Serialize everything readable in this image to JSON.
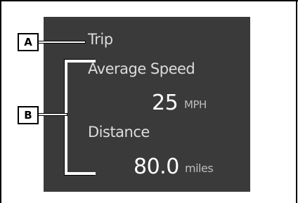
{
  "callouts": {
    "a": "A",
    "b": "B"
  },
  "display": {
    "title": "Trip",
    "average_speed_label": "Average Speed",
    "speed_value": "25",
    "speed_unit": "MPH",
    "distance_label": "Distance",
    "distance_value": "80.0",
    "distance_unit": "miles"
  },
  "colors": {
    "screen_background": "#3a3a3b",
    "label_text": "#dcdcdc",
    "value_text": "#ffffff",
    "unit_text": "#bdbdbd",
    "callout_border": "#000000"
  }
}
